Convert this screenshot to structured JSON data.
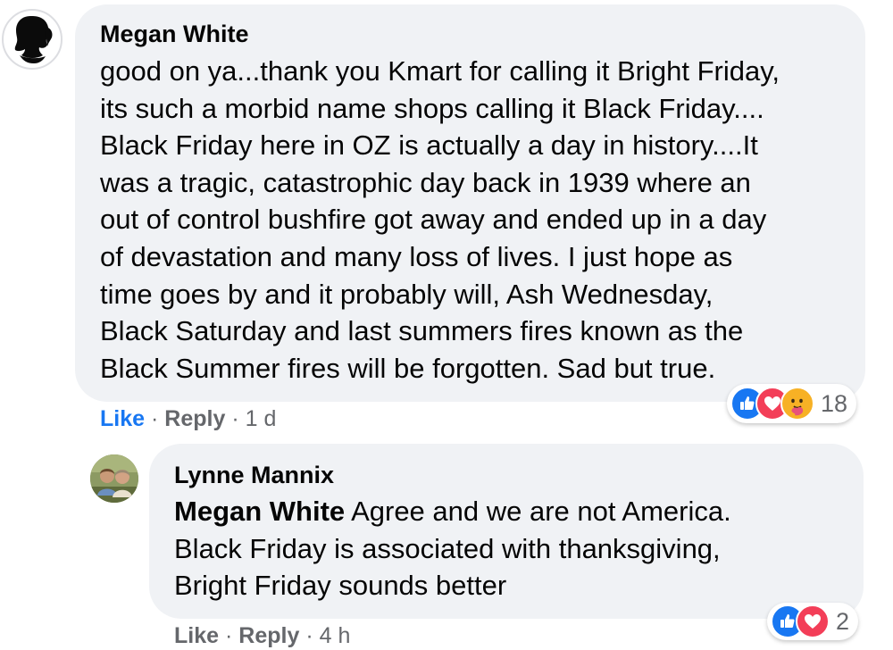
{
  "comments": [
    {
      "author": "Megan White",
      "lines": [
        "good on ya...thank you Kmart for calling it Bright Friday,",
        "its such a morbid name shops calling it Black Friday....",
        "Black Friday here in OZ is actually a day in history....It",
        "was a tragic, catastrophic day back in 1939 where an",
        "out of control bushfire got away and ended up in a day",
        "of devastation and many loss of lives. I just hope as",
        "time goes by and it probably will, Ash Wednesday,",
        "Black Saturday and last summers fires known as the",
        "Black Summer fires will be forgotten. Sad but true."
      ],
      "actions": {
        "like": "Like",
        "separator": "·",
        "reply": "Reply",
        "time": "1 d"
      },
      "reactions": {
        "count": "18",
        "types": [
          "like-icon",
          "love-icon",
          "care-icon"
        ],
        "colors": {
          "like": "#1877f2",
          "love": "#f33e58",
          "care": "#f7b125"
        }
      },
      "like_active": true
    },
    {
      "author": "Lynne Mannix",
      "mention": "Megan White",
      "first_line_rest": " Agree and we are not America.",
      "lines": [
        "Black Friday is associated with thanksgiving,",
        "Bright Friday sounds better"
      ],
      "actions": {
        "like": "Like",
        "separator": "·",
        "reply": "Reply",
        "time": "4 h"
      },
      "reactions": {
        "count": "2",
        "types": [
          "like-icon",
          "love-icon"
        ]
      },
      "like_active": false
    }
  ],
  "colors": {
    "bubble": "#f0f2f5",
    "link_active": "#1877f2",
    "meta_text": "#65676b",
    "text": "#050505"
  }
}
